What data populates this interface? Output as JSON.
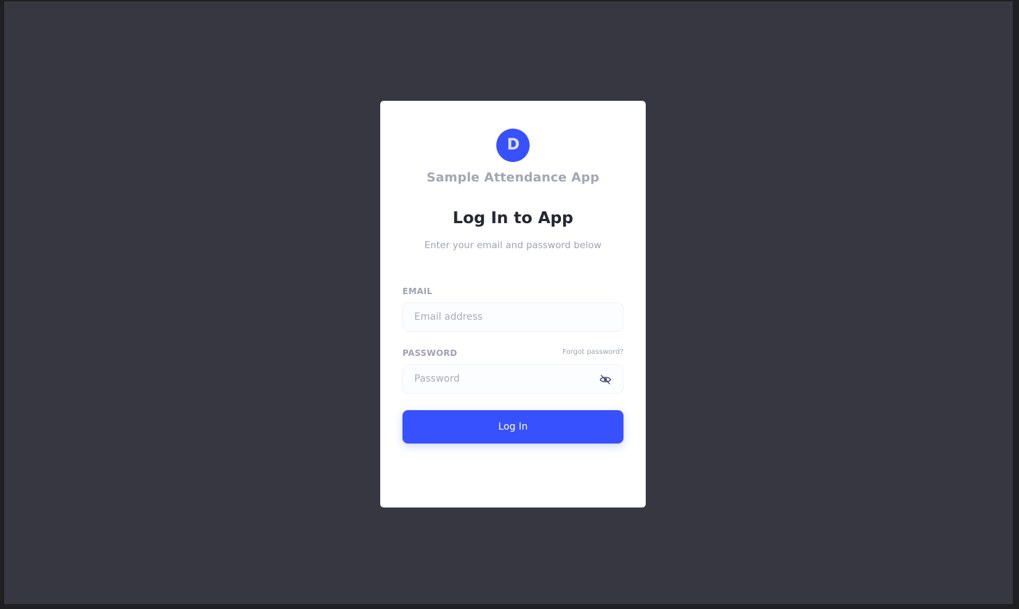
{
  "app": {
    "logo_letter": "D",
    "name": "Sample Attendance App"
  },
  "login": {
    "title": "Log In to App",
    "subtitle": "Enter your email and password below",
    "email": {
      "label": "EMAIL",
      "placeholder": "Email address",
      "value": ""
    },
    "password": {
      "label": "PASSWORD",
      "placeholder": "Password",
      "value": "",
      "forgot_label": "Forgot password?",
      "toggle_icon": "eye-off-icon"
    },
    "submit_label": "Log In"
  },
  "colors": {
    "accent": "#3751ff",
    "background": "#373741",
    "card": "#ffffff",
    "title": "#252733",
    "muted": "#9fa2b4"
  }
}
